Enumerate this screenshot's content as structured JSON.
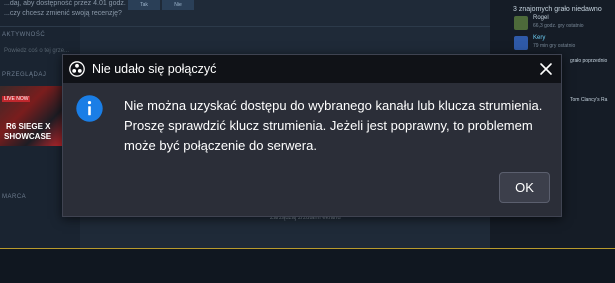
{
  "background": {
    "review_text_1": "...daj, aby dostępność przez 4.01 godz.",
    "review_text_2": "...czy chcesz zmienić swoją recenzję?",
    "yes_label": "Tak",
    "no_label": "Nie",
    "section_activity": "AKTYWNOŚĆ",
    "comment_placeholder": "Powiedz coś o tej grze...",
    "section_browse": "PRZEGLĄDAJ",
    "thumb_badge": "LIVE NOW",
    "thumb_title_1": "R6 SIEGE X",
    "thumb_title_2": "SHOWCASE",
    "section_march": "MARCA",
    "manage_screenshots": "Zarządzaj zrzutami ekranu",
    "friends_title": "3 znajomych grało niedawno",
    "friends": [
      {
        "name": "Rogel",
        "sub": "66,3 godz. gry ostatnio"
      },
      {
        "name": "Kery",
        "sub": "79 min gry ostatnio"
      }
    ],
    "friends_prev": "grało poprzednio",
    "game_title": "Tom Clancy's Ra"
  },
  "dialog": {
    "title": "Nie udało się połączyć",
    "message": "Nie można uzyskać dostępu do wybranego kanału lub klucza strumienia. Proszę sprawdzić klucz strumienia. Jeżeli jest poprawny, to problemem może być połączenie do serwera.",
    "ok_label": "OK",
    "icons": {
      "title": "obs-icon",
      "info": "info-icon",
      "close": "close-icon"
    },
    "colors": {
      "titlebar": "#101217",
      "body": "#2b2e38",
      "info": "#1a7ee6"
    }
  }
}
